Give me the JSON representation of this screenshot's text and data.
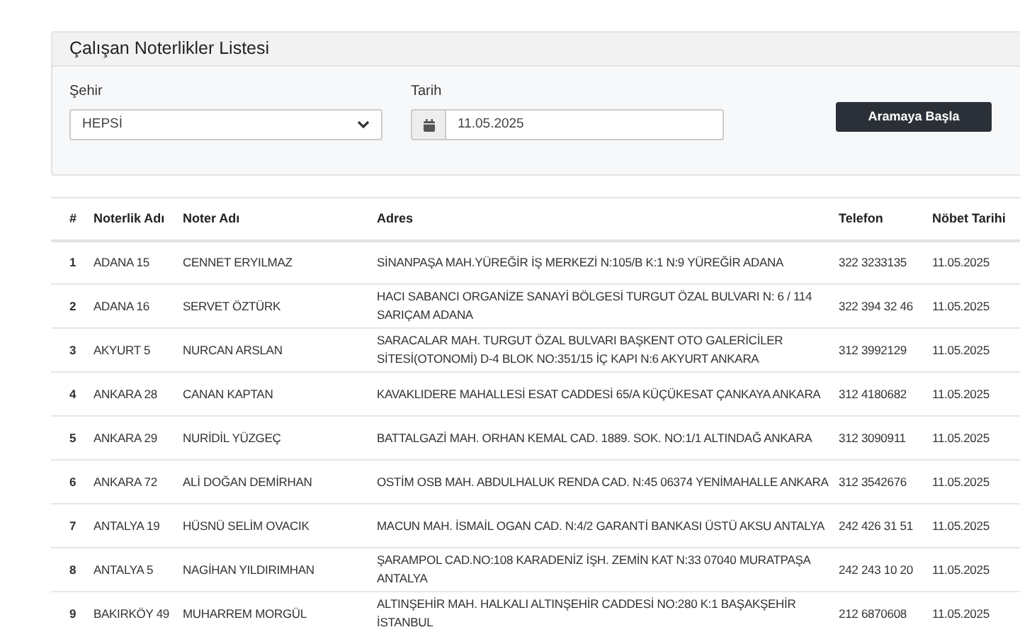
{
  "panel": {
    "title": "Çalışan Noterlikler Listesi"
  },
  "filters": {
    "city": {
      "label": "Şehir",
      "value": "HEPSİ"
    },
    "date": {
      "label": "Tarih",
      "value": "11.05.2025"
    },
    "search_button": "Aramaya Başla"
  },
  "table": {
    "columns": [
      "#",
      "Noterlik Adı",
      "Noter Adı",
      "Adres",
      "Telefon",
      "Nöbet Tarihi"
    ],
    "rows": [
      [
        "1",
        "ADANA 15",
        "CENNET ERYILMAZ",
        "SİNANPAŞA MAH.YÜREĞİR İŞ MERKEZİ N:105/B K:1 N:9 YÜREĞİR ADANA",
        "322 3233135",
        "11.05.2025"
      ],
      [
        "2",
        "ADANA 16",
        "SERVET ÖZTÜRK",
        "HACI SABANCI ORGANİZE SANAYİ BÖLGESİ TURGUT ÖZAL BULVARI N: 6 / 114 SARIÇAM ADANA",
        "322 394 32 46",
        "11.05.2025"
      ],
      [
        "3",
        "AKYURT 5",
        "NURCAN ARSLAN",
        "SARACALAR MAH. TURGUT ÖZAL BULVARI BAŞKENT OTO GALERİCİLER SİTESİ(OTONOMİ) D-4 BLOK NO:351/15 İÇ KAPI N:6 AKYURT ANKARA",
        "312 3992129",
        "11.05.2025"
      ],
      [
        "4",
        "ANKARA 28",
        "CANAN KAPTAN",
        "KAVAKLIDERE MAHALLESİ ESAT CADDESİ 65/A KÜÇÜKESAT ÇANKAYA ANKARA",
        "312 4180682",
        "11.05.2025"
      ],
      [
        "5",
        "ANKARA 29",
        "NURİDİL YÜZGEÇ",
        "BATTALGAZİ MAH. ORHAN KEMAL CAD. 1889. SOK. NO:1/1 ALTINDAĞ ANKARA",
        "312 3090911",
        "11.05.2025"
      ],
      [
        "6",
        "ANKARA 72",
        "ALİ DOĞAN DEMİRHAN",
        "OSTİM OSB MAH. ABDULHALUK RENDA CAD. N:45 06374 YENİMAHALLE ANKARA",
        "312 3542676",
        "11.05.2025"
      ],
      [
        "7",
        "ANTALYA 19",
        "HÜSNÜ SELİM OVACIK",
        "MACUN MAH. İSMAİL OGAN CAD. N:4/2 GARANTİ BANKASI ÜSTÜ AKSU ANTALYA",
        "242 426 31 51",
        "11.05.2025"
      ],
      [
        "8",
        "ANTALYA 5",
        "NAGİHAN YILDIRIMHAN",
        "ŞARAMPOL CAD.NO:108 KARADENİZ İŞH. ZEMİN KAT N:33 07040 MURATPAŞA ANTALYA",
        "242 243 10 20",
        "11.05.2025"
      ],
      [
        "9",
        "BAKIRKÖY 49",
        "MUHARREM MORGÜL",
        "ALTINŞEHİR MAH. HALKALI ALTINŞEHİR CADDESİ NO:280 K:1 BAŞAKŞEHİR İSTANBUL",
        "212 6870608",
        "11.05.2025"
      ]
    ]
  }
}
